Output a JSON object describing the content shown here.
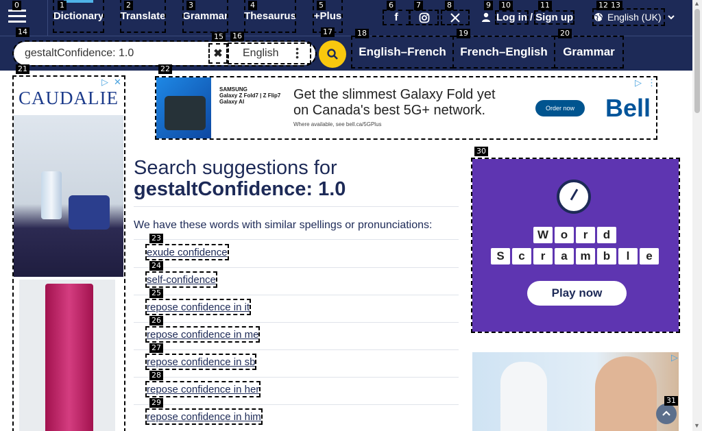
{
  "nav": {
    "items": [
      {
        "label": "Dictionary"
      },
      {
        "label": "Translate"
      },
      {
        "label": "Grammar"
      },
      {
        "label": "Thesaurus"
      },
      {
        "label": "+Plus"
      }
    ],
    "social": [
      "facebook-icon",
      "instagram-icon",
      "x-icon"
    ],
    "login": "Log in",
    "slash": "/",
    "signup": "Sign up",
    "language": "English (UK)"
  },
  "search": {
    "value": "gestaltConfidence: 1.0",
    "dictionary": "English"
  },
  "quick_links": [
    "English–French",
    "French–English",
    "Grammar"
  ],
  "main": {
    "heading_prefix": "Search suggestions for",
    "heading_query": "gestaltConfidence: 1.0",
    "intro": "We have these words with similar spellings or pronunciations:",
    "suggestions": [
      "exude confidence",
      "self-confidence",
      "repose confidence in it",
      "repose confidence in me",
      "repose confidence in sb",
      "repose confidence in her",
      "repose confidence in him"
    ]
  },
  "ads": {
    "left_brand": "CAUDALIE",
    "banner_brand": "SAMSUNG\nGalaxy Z Fold7 | Z Flip7\nGalaxy AI",
    "banner_headline": "Get the slimmest Galaxy Fold yet on Canada's best 5G+ network.",
    "banner_sub": "Where available, see bell.ca/5GPlus",
    "banner_cta": "Order now",
    "banner_logo": "Bell",
    "game_letters_1": [
      "W",
      "o",
      "r",
      "d"
    ],
    "game_letters_2": [
      "S",
      "c",
      "r",
      "a",
      "m",
      "b",
      "l",
      "e"
    ],
    "game_cta": "Play now"
  },
  "marks": [
    "0",
    "1",
    "2",
    "3",
    "4",
    "5",
    "6",
    "7",
    "8",
    "9",
    "10",
    "11",
    "12",
    "13",
    "14",
    "15",
    "16",
    "17",
    "18",
    "19",
    "20",
    "21",
    "22",
    "23",
    "24",
    "25",
    "26",
    "27",
    "28",
    "29",
    "30",
    "31"
  ],
  "colors": {
    "nav_bg": "#1d2a57",
    "accent": "#f9c80e",
    "game_bg": "#5e35b1"
  }
}
